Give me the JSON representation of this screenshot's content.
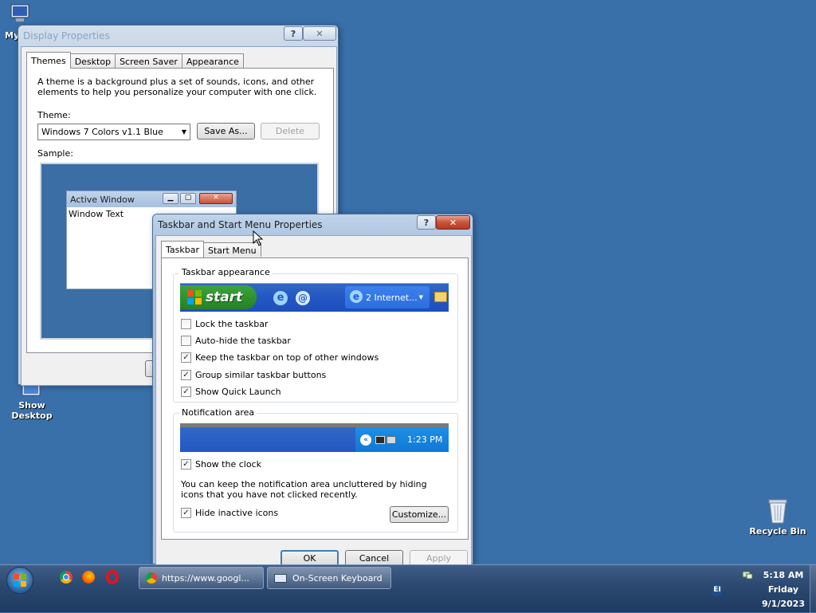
{
  "desktop": {
    "icons": {
      "my_computer_label": "My",
      "show_desktop_label_1": "Show",
      "show_desktop_label_2": "Desktop",
      "recycle_bin_label": "Recycle Bin"
    }
  },
  "display_properties": {
    "title": "Display Properties",
    "help_btn": "?",
    "close_btn": "✕",
    "tabs": [
      "Themes",
      "Desktop",
      "Screen Saver",
      "Appearance"
    ],
    "active_tab": "Themes",
    "description": "A theme is a background plus a set of sounds, icons, and other elements to help you personalize your computer with one click.",
    "theme_label": "Theme:",
    "theme_value": "Windows 7 Colors v1.1 Blue",
    "save_as_label": "Save As...",
    "delete_label": "Delete",
    "sample_label": "Sample:",
    "sample_window_title": "Active Window",
    "sample_window_text": "Window Text"
  },
  "taskbar_properties": {
    "title": "Taskbar and Start Menu Properties",
    "help_btn": "?",
    "close_btn": "✕",
    "tabs": [
      "Taskbar",
      "Start Menu"
    ],
    "active_tab": "Taskbar",
    "appearance_group": "Taskbar appearance",
    "preview": {
      "start_label": "start",
      "task_label": "2 Internet..."
    },
    "options": [
      {
        "label": "Lock the taskbar",
        "checked": false
      },
      {
        "label": "Auto-hide the taskbar",
        "checked": false
      },
      {
        "label": "Keep the taskbar on top of other windows",
        "checked": true
      },
      {
        "label": "Group similar taskbar buttons",
        "checked": true
      },
      {
        "label": "Show Quick Launch",
        "checked": true
      }
    ],
    "notification_group": "Notification area",
    "notif_preview_time": "1:23 PM",
    "show_clock": {
      "label": "Show the clock",
      "checked": true
    },
    "notification_text": "You can keep the notification area uncluttered by hiding icons that you have not clicked recently.",
    "hide_inactive": {
      "label": "Hide inactive icons",
      "checked": true
    },
    "customize_label": "Customize...",
    "ok_label": "OK",
    "cancel_label": "Cancel",
    "apply_label": "Apply"
  },
  "taskbar": {
    "quick_launch": [
      "chrome-icon",
      "firefox-icon",
      "opera-icon"
    ],
    "tasks": [
      {
        "label": "https://www.googl...",
        "icon": "chrome-icon"
      },
      {
        "label": "On-Screen Keyboard",
        "icon": "keyboard-icon"
      }
    ],
    "language": "EI",
    "clock": {
      "time": "5:18 AM",
      "day": "Friday",
      "date": "9/1/2023"
    }
  }
}
